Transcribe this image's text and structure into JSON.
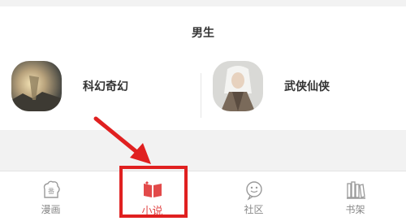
{
  "section": {
    "title": "男生"
  },
  "genres": [
    {
      "label": "科幻奇幻"
    },
    {
      "label": "武侠仙侠"
    }
  ],
  "tabs": [
    {
      "label": "漫画",
      "icon": "comic-icon",
      "badge": "番"
    },
    {
      "label": "小说",
      "icon": "book-icon"
    },
    {
      "label": "社区",
      "icon": "chat-icon"
    },
    {
      "label": "书架",
      "icon": "bookshelf-icon"
    }
  ],
  "colors": {
    "accent": "#e24a4a",
    "highlight": "#e02020",
    "muted": "#888888"
  },
  "active_tab": "小说"
}
